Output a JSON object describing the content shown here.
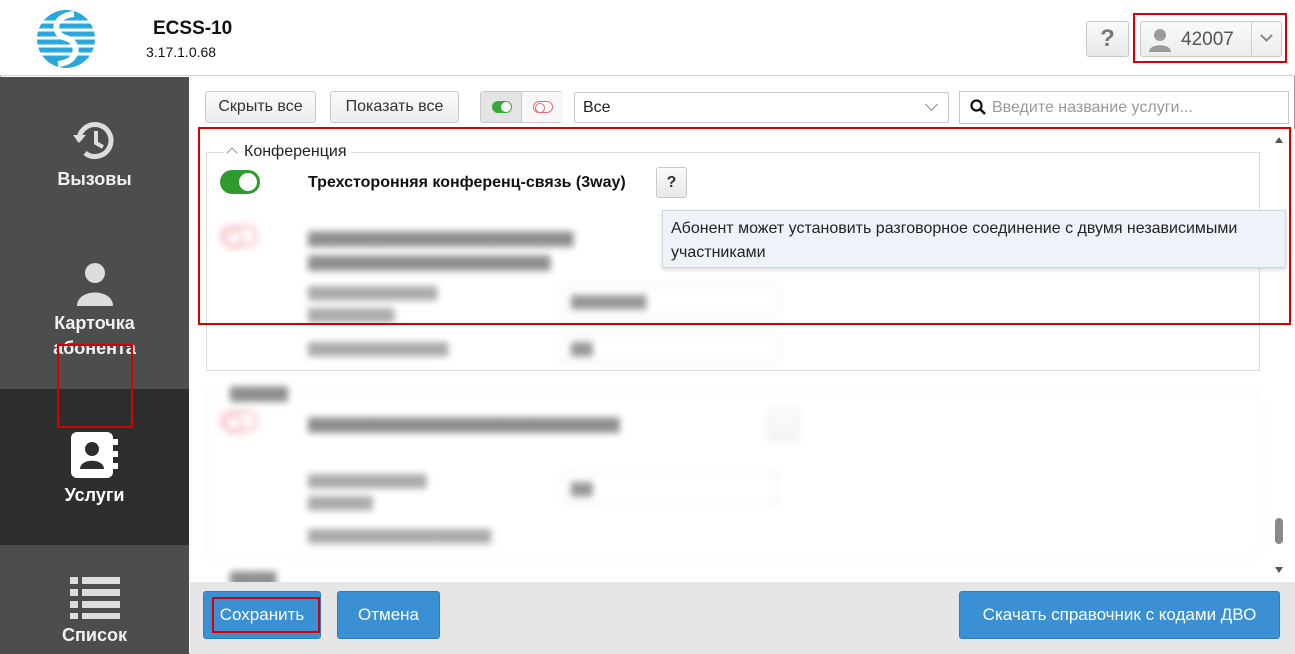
{
  "header": {
    "app_title": "ECSS-10",
    "app_version": "3.17.1.0.68",
    "help_label": "?",
    "user_id": "42007"
  },
  "sidebar": {
    "items": [
      {
        "label": "Вызовы",
        "icon": "history-icon"
      },
      {
        "label_line1": "Карточка",
        "label_line2": "абонента",
        "icon": "person-icon"
      },
      {
        "label": "Услуги",
        "icon": "contact-book-icon",
        "active": true
      },
      {
        "label": "Список",
        "icon": "list-icon"
      }
    ]
  },
  "toolbar": {
    "collapse_all": "Скрыть все",
    "expand_all": "Показать все",
    "filter_value": "Все",
    "search_placeholder": "Введите название услуги..."
  },
  "groups": [
    {
      "caption": "Конференция",
      "services": [
        {
          "title": "Трехсторонняя конференц-связь (3way)",
          "enabled": true,
          "help": "?"
        }
      ]
    }
  ],
  "tooltip": {
    "line1": "Абонент может установить разговорное соединение с двумя независимыми",
    "line2": "участниками"
  },
  "footer": {
    "save": "Сохранить",
    "cancel": "Отмена",
    "download": "Скачать справочник с кодами ДВО"
  },
  "colors": {
    "accent_blue": "#3b8fd3",
    "switch_on": "#2f9a2f",
    "switch_off": "#ef8b8b",
    "highlight_red": "#d60000",
    "sidebar_bg": "#4d4d4d"
  }
}
